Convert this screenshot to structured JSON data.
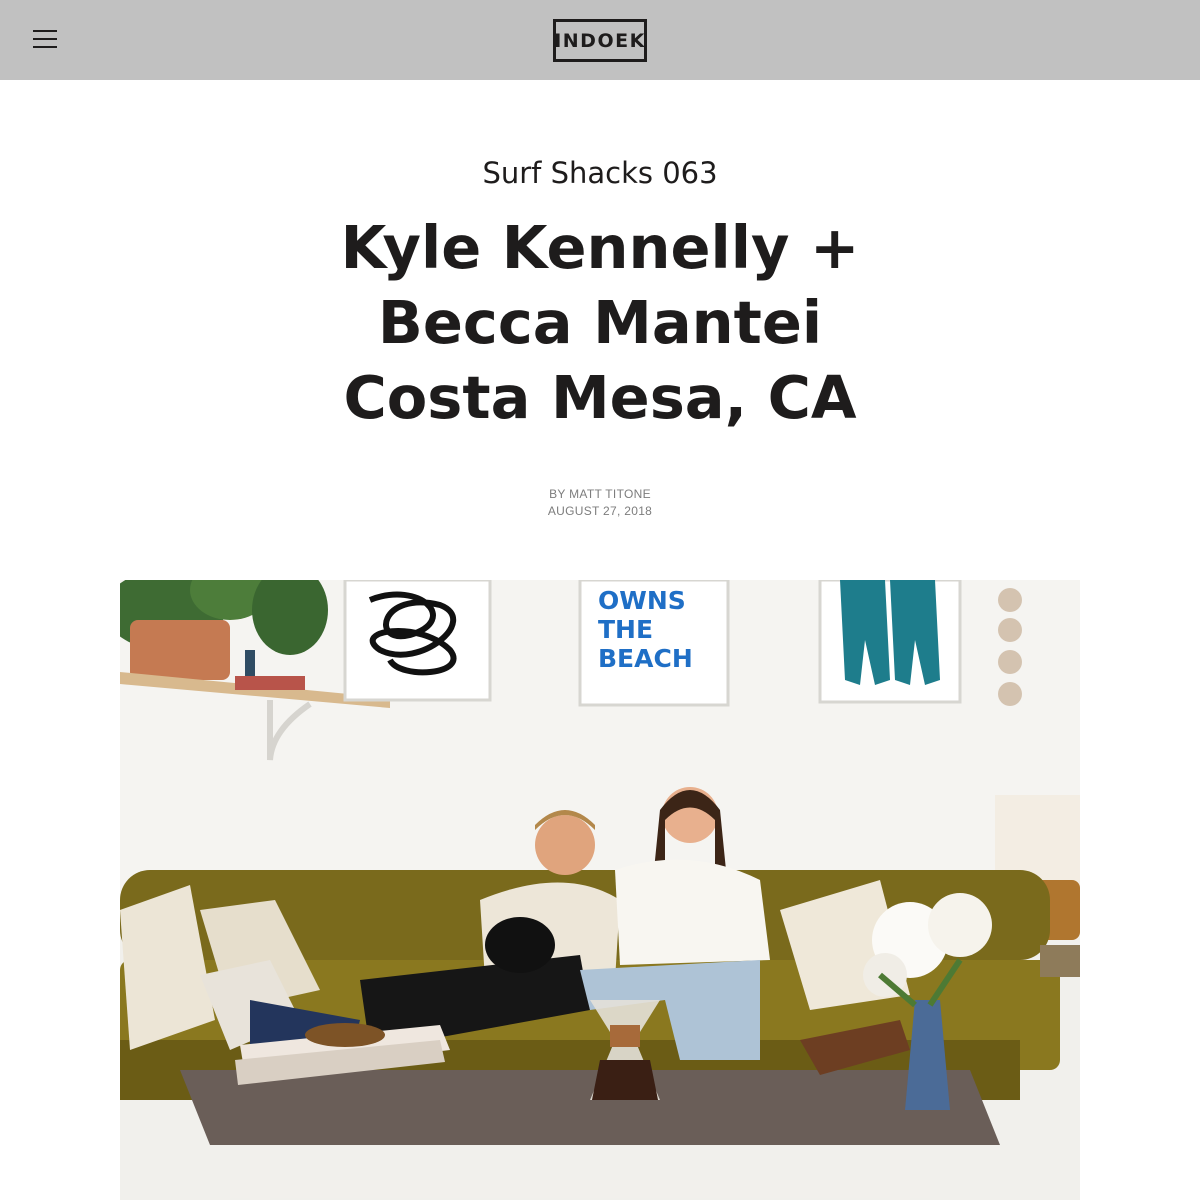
{
  "header": {
    "menu_icon": "hamburger-menu-icon",
    "logo_text": "INDOEK",
    "background": "#c1c1c1"
  },
  "article": {
    "kicker": "Surf Shacks 063",
    "headline_lines": [
      "Kyle Kennelly +",
      "Becca Mantei",
      "Costa Mesa, CA"
    ],
    "byline": "By Matt Titone",
    "date": "August 27, 2018"
  },
  "hero_image": {
    "subject": "couple-on-sofa-photo",
    "poster_text": [
      "OWNS",
      "THE",
      "BEACH"
    ]
  }
}
